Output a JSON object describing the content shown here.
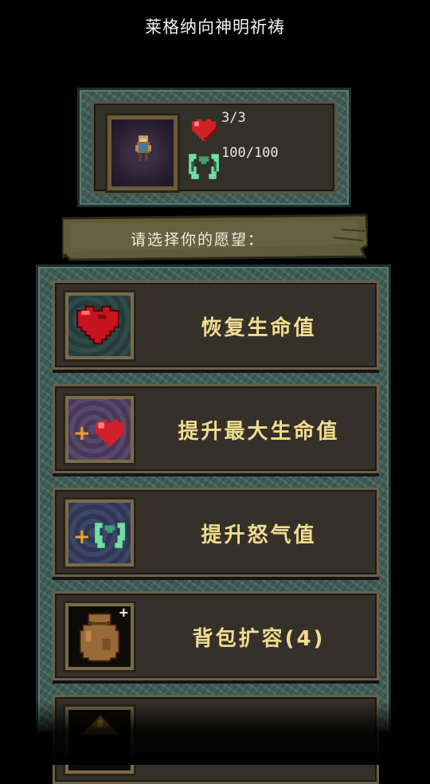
{
  "header": {
    "title": "莱格纳向神明祈祷"
  },
  "status": {
    "health": "3/3",
    "rage": "100/100",
    "portrait_icon": "hero-portrait-icon",
    "health_icon": "heart-icon",
    "rage_icon": "rage-claw-icon"
  },
  "prompt": {
    "text": "请选择你的愿望："
  },
  "options": [
    {
      "label": "恢复生命值",
      "icon": "heart-icon"
    },
    {
      "label": "提升最大生命值",
      "icon": "plus-heart-icon"
    },
    {
      "label": "提升怒气值",
      "icon": "plus-rage-icon"
    },
    {
      "label": "背包扩容(4)",
      "icon": "backpack-icon"
    },
    {
      "label": "",
      "icon": "partially-visible-icon"
    }
  ],
  "colors": {
    "option_text": "#f1dc8f",
    "option_bg": "#35312a",
    "frame_teal": "#3e5e57",
    "plus_orange": "#f0a030",
    "heart_red": "#d0202a",
    "rage_green": "#6fe0a0"
  }
}
